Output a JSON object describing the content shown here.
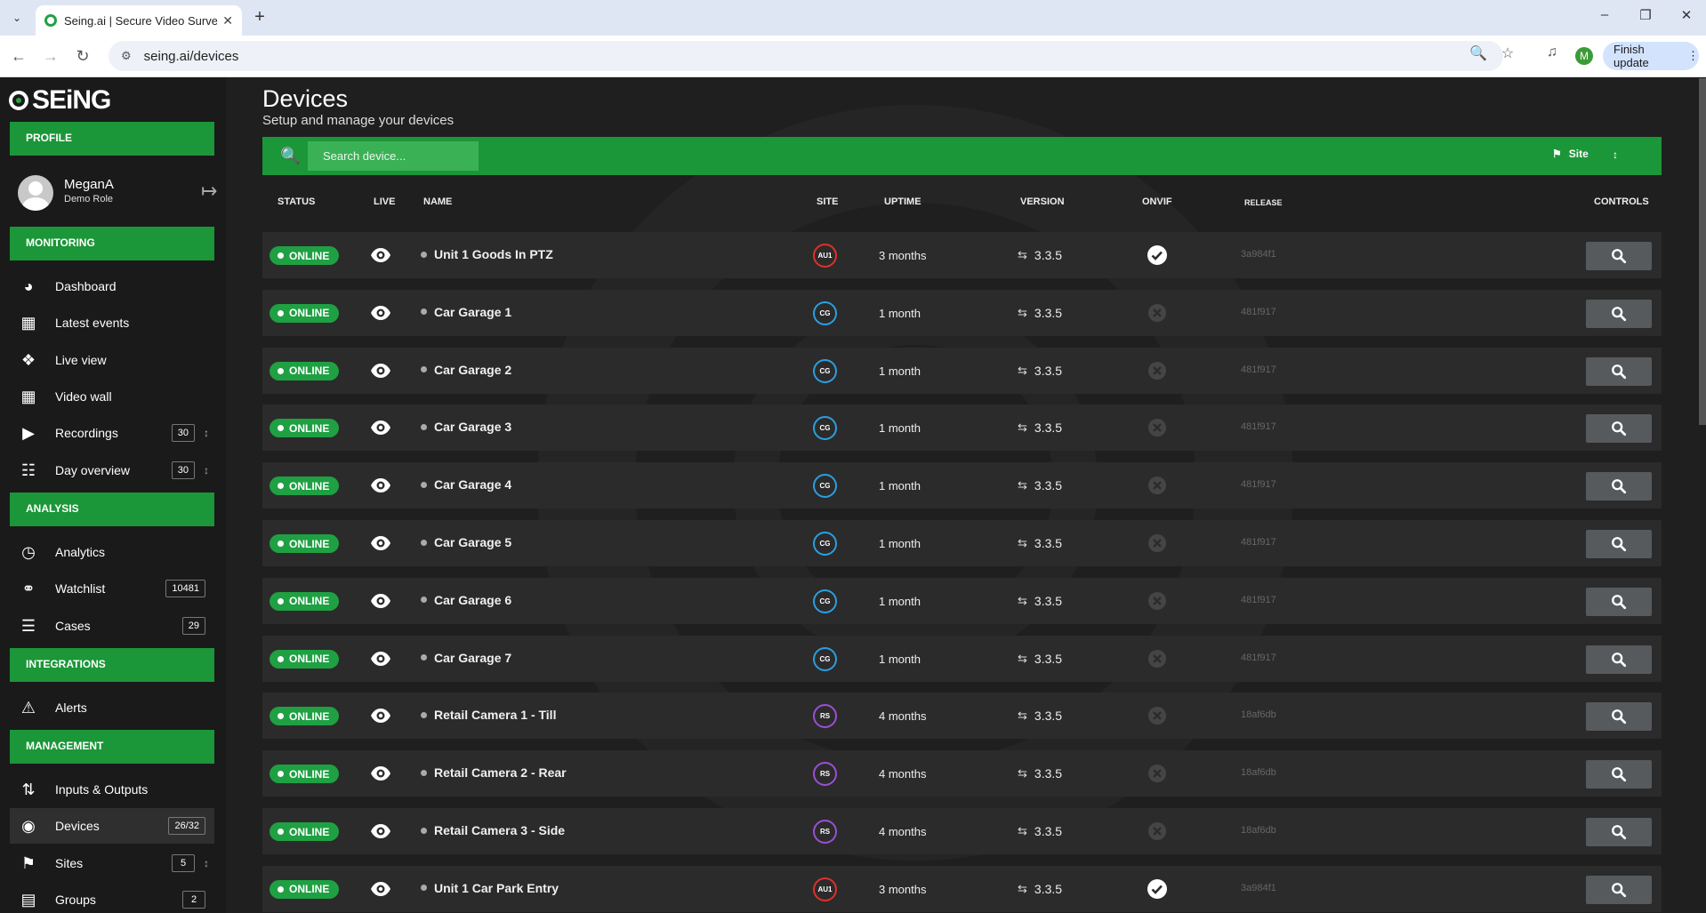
{
  "browser": {
    "tab_title": "Seing.ai | Secure Video Surveillance",
    "url": "seing.ai/devices",
    "finish_update": "Finish update",
    "profile_initial": "M"
  },
  "sidebar": {
    "logo": "SEiNG",
    "profile_section": "PROFILE",
    "user_name": "MeganA",
    "user_role": "Demo Role",
    "monitoring_section": "MONITORING",
    "analysis_section": "ANALYSIS",
    "integrations_section": "INTEGRATIONS",
    "management_section": "MANAGEMENT",
    "items": {
      "dashboard": "Dashboard",
      "latest_events": "Latest events",
      "live_view": "Live view",
      "video_wall": "Video wall",
      "recordings": "Recordings",
      "recordings_count": "30",
      "day_overview": "Day overview",
      "day_overview_count": "30",
      "analytics": "Analytics",
      "watchlist": "Watchlist",
      "watchlist_count": "10481",
      "cases": "Cases",
      "cases_count": "29",
      "alerts": "Alerts",
      "inputs_outputs": "Inputs & Outputs",
      "devices": "Devices",
      "devices_count": "26/32",
      "sites": "Sites",
      "sites_count": "5",
      "groups": "Groups",
      "groups_count": "2"
    }
  },
  "main": {
    "title": "Devices",
    "subtitle": "Setup and manage your devices",
    "search_placeholder": "Search device...",
    "site_button": "Site",
    "columns": {
      "status": "STATUS",
      "live": "LIVE",
      "name": "NAME",
      "site": "SITE",
      "uptime": "UPTIME",
      "version": "VERSION",
      "onvif": "ONVIF",
      "release": "RELEASE",
      "controls": "CONTROLS"
    }
  },
  "devices": [
    {
      "status": "ONLINE",
      "name": "Unit 1 Goods In PTZ",
      "site": "AU1",
      "site_color": "#e0302a",
      "uptime": "3 months",
      "version": "3.3.5",
      "onvif": true,
      "release": "3a984f1"
    },
    {
      "status": "ONLINE",
      "name": "Car Garage 1",
      "site": "CG",
      "site_color": "#2a9fe0",
      "uptime": "1 month",
      "version": "3.3.5",
      "onvif": false,
      "release": "481f917"
    },
    {
      "status": "ONLINE",
      "name": "Car Garage 2",
      "site": "CG",
      "site_color": "#2a9fe0",
      "uptime": "1 month",
      "version": "3.3.5",
      "onvif": false,
      "release": "481f917"
    },
    {
      "status": "ONLINE",
      "name": "Car Garage 3",
      "site": "CG",
      "site_color": "#2a9fe0",
      "uptime": "1 month",
      "version": "3.3.5",
      "onvif": false,
      "release": "481f917"
    },
    {
      "status": "ONLINE",
      "name": "Car Garage 4",
      "site": "CG",
      "site_color": "#2a9fe0",
      "uptime": "1 month",
      "version": "3.3.5",
      "onvif": false,
      "release": "481f917"
    },
    {
      "status": "ONLINE",
      "name": "Car Garage 5",
      "site": "CG",
      "site_color": "#2a9fe0",
      "uptime": "1 month",
      "version": "3.3.5",
      "onvif": false,
      "release": "481f917"
    },
    {
      "status": "ONLINE",
      "name": "Car Garage 6",
      "site": "CG",
      "site_color": "#2a9fe0",
      "uptime": "1 month",
      "version": "3.3.5",
      "onvif": false,
      "release": "481f917"
    },
    {
      "status": "ONLINE",
      "name": "Car Garage 7",
      "site": "CG",
      "site_color": "#2a9fe0",
      "uptime": "1 month",
      "version": "3.3.5",
      "onvif": false,
      "release": "481f917"
    },
    {
      "status": "ONLINE",
      "name": "Retail Camera 1 - Till",
      "site": "RS",
      "site_color": "#9a4fd6",
      "uptime": "4 months",
      "version": "3.3.5",
      "onvif": false,
      "release": "18af6db"
    },
    {
      "status": "ONLINE",
      "name": "Retail Camera 2 - Rear",
      "site": "RS",
      "site_color": "#9a4fd6",
      "uptime": "4 months",
      "version": "3.3.5",
      "onvif": false,
      "release": "18af6db"
    },
    {
      "status": "ONLINE",
      "name": "Retail Camera 3 - Side",
      "site": "RS",
      "site_color": "#9a4fd6",
      "uptime": "4 months",
      "version": "3.3.5",
      "onvif": false,
      "release": "18af6db"
    },
    {
      "status": "ONLINE",
      "name": "Unit 1 Car Park Entry",
      "site": "AU1",
      "site_color": "#e0302a",
      "uptime": "3 months",
      "version": "3.3.5",
      "onvif": true,
      "release": "3a984f1"
    }
  ]
}
